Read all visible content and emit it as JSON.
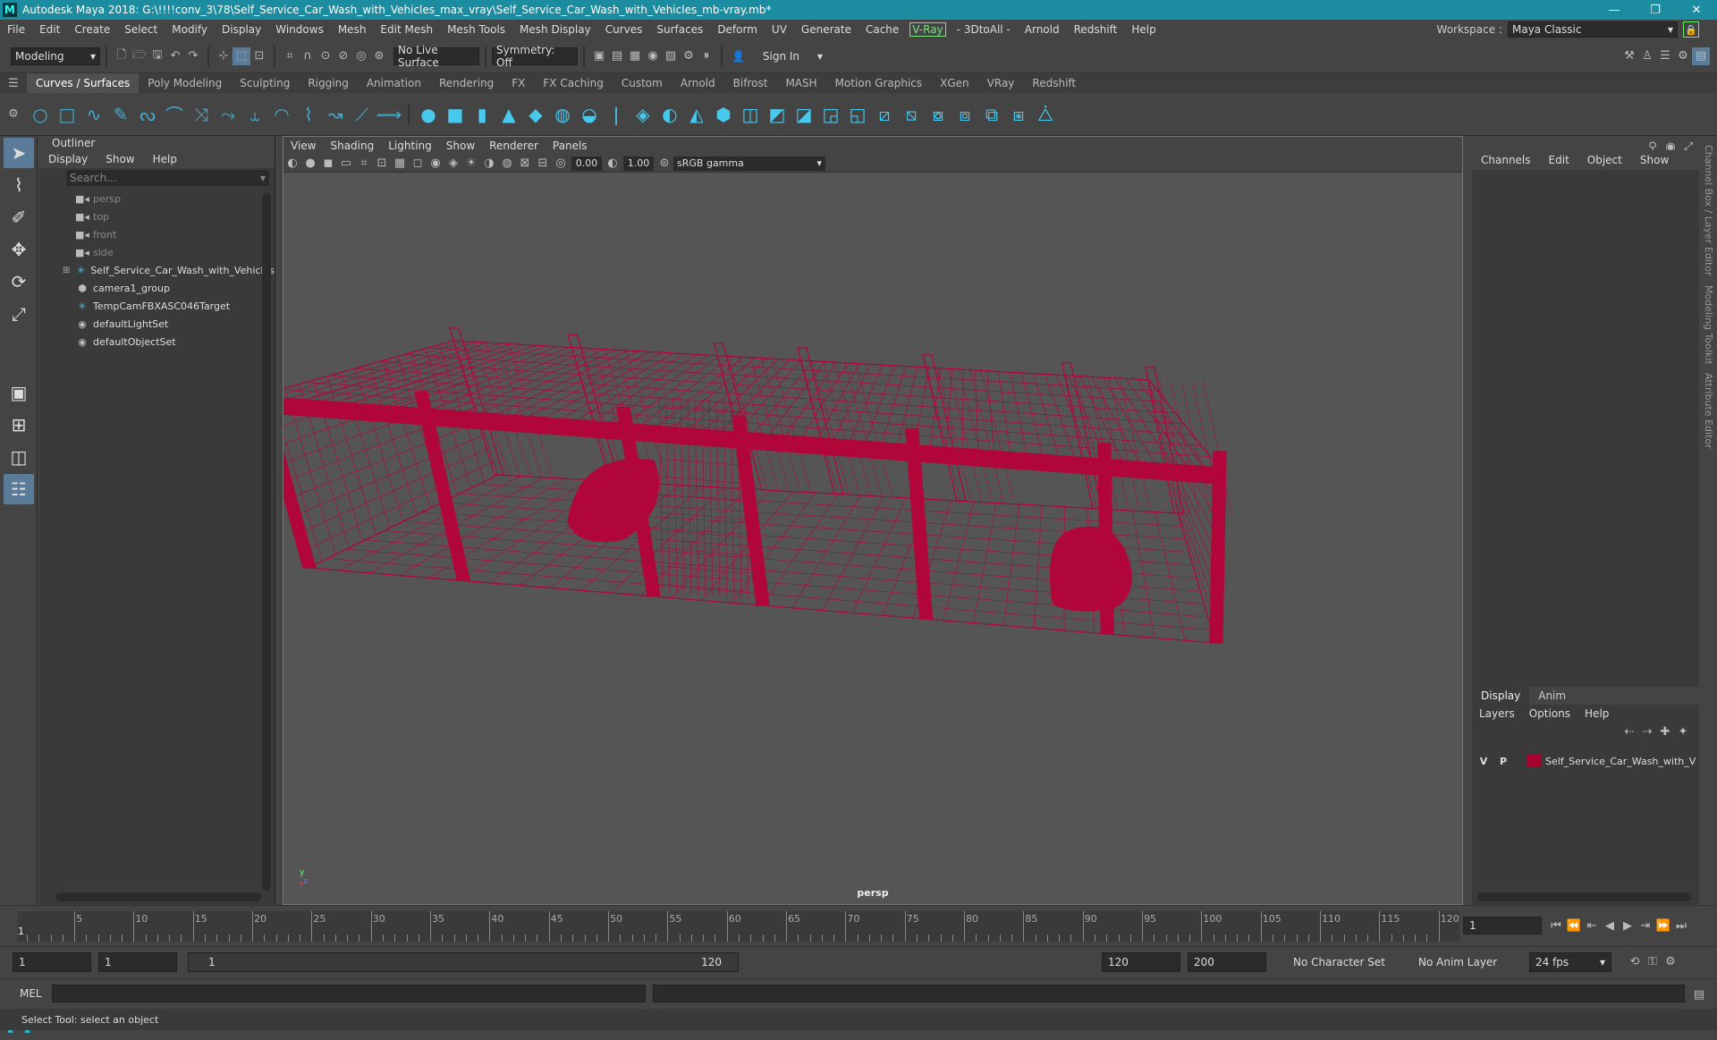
{
  "window": {
    "title": "Autodesk Maya 2018: G:\\!!!!conv_3\\78\\Self_Service_Car_Wash_with_Vehicles_max_vray\\Self_Service_Car_Wash_with_Vehicles_mb-vray.mb*",
    "logo": "M"
  },
  "menu": [
    "File",
    "Edit",
    "Create",
    "Select",
    "Modify",
    "Display",
    "Windows",
    "Mesh",
    "Edit Mesh",
    "Mesh Tools",
    "Mesh Display",
    "Curves",
    "Surfaces",
    "Deform",
    "UV",
    "Generate",
    "Cache"
  ],
  "menu_vray": "V-Ray",
  "menu_tail": [
    "- 3DtoAll -",
    "Arnold",
    "Redshift",
    "Help"
  ],
  "workspace": {
    "label": "Workspace :",
    "value": "Maya Classic"
  },
  "status": {
    "mode": "Modeling",
    "live_surface": "No Live Surface",
    "symmetry": "Symmetry: Off",
    "sign_in": "Sign In"
  },
  "shelf_tabs": [
    "Curves / Surfaces",
    "Poly Modeling",
    "Sculpting",
    "Rigging",
    "Animation",
    "Rendering",
    "FX",
    "FX Caching",
    "Custom",
    "Arnold",
    "Bifrost",
    "MASH",
    "Motion Graphics",
    "XGen",
    "VRay",
    "Redshift"
  ],
  "outliner": {
    "title": "Outliner",
    "menu": [
      "Display",
      "Show",
      "Help"
    ],
    "search_placeholder": "Search...",
    "items": [
      {
        "label": "persp",
        "icon": "camera-icon",
        "dim": true
      },
      {
        "label": "top",
        "icon": "camera-icon",
        "dim": true
      },
      {
        "label": "front",
        "icon": "camera-icon",
        "dim": true
      },
      {
        "label": "side",
        "icon": "camera-icon",
        "dim": true
      },
      {
        "label": "Self_Service_Car_Wash_with_Vehicles",
        "icon": "transform-icon",
        "dim": false,
        "expand": "⊞"
      },
      {
        "label": "camera1_group",
        "icon": "group-icon",
        "dim": false
      },
      {
        "label": "TempCamFBXASC046Target",
        "icon": "transform-icon",
        "dim": false
      },
      {
        "label": "defaultLightSet",
        "icon": "set-icon",
        "dim": false
      },
      {
        "label": "defaultObjectSet",
        "icon": "set-icon",
        "dim": false
      }
    ]
  },
  "viewport": {
    "menu": [
      "View",
      "Shading",
      "Lighting",
      "Show",
      "Renderer",
      "Panels"
    ],
    "exposure": "0.00",
    "gamma_value": "1.00",
    "color_space": "sRGB gamma",
    "camera": "persp",
    "wire_color": "#b0063a"
  },
  "channel_box": {
    "menu": [
      "Channels",
      "Edit",
      "Object",
      "Show"
    ]
  },
  "layers": {
    "tabs": [
      "Display",
      "Anim"
    ],
    "menu": [
      "Layers",
      "Options",
      "Help"
    ],
    "row": {
      "v": "V",
      "p": "P",
      "name": "Self_Service_Car_Wash_with_V",
      "color": "#a5002e"
    }
  },
  "side_tabs": [
    "Channel Box / Layer Editor",
    "Modeling Toolkit",
    "Attribute Editor"
  ],
  "timeline": {
    "ticks": [
      "5",
      "10",
      "15",
      "20",
      "25",
      "30",
      "35",
      "40",
      "45",
      "50",
      "55",
      "60",
      "65",
      "70",
      "75",
      "80",
      "85",
      "90",
      "95",
      "100",
      "105",
      "110",
      "115",
      "120"
    ],
    "start_marker": "1",
    "current_frame": "1"
  },
  "range": {
    "start": "1",
    "playback_start": "1",
    "slider_start": "1",
    "slider_end": "120",
    "playback_end": "120",
    "end": "200",
    "character_set": "No Character Set",
    "anim_layer": "No Anim Layer",
    "fps": "24 fps"
  },
  "cmd": {
    "label": "MEL"
  },
  "help_line": "Select Tool: select an object"
}
